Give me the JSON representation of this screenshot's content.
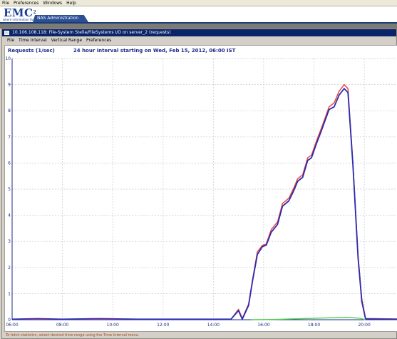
{
  "top_menu": [
    "File",
    "Preferences",
    "Windows",
    "Help"
  ],
  "brand": {
    "logo": "EMC",
    "tagline": "where information lives",
    "app_tab": "NAS Administration"
  },
  "window": {
    "title": "10.106.108.118: File-System Stella/FileSystems I/O on server_2 (requests)",
    "menu": [
      "File",
      "Time Interval",
      "Vertical Range",
      "Preferences"
    ]
  },
  "chart_header": {
    "metric": "Requests (1/sec)",
    "interval": "24 hour interval starting on Wed, Feb 15, 2012, 06:00 IST"
  },
  "status_text": "To fetch statistics, select desired time range using the Time Interval menu.",
  "chart_data": {
    "type": "line",
    "title": "24 hour interval starting on Wed, Feb 15, 2012, 06:00 IST",
    "ylabel": "Requests (1/sec)",
    "xlabel": "",
    "x_unit": "hours",
    "xlim": [
      6.0,
      21.3
    ],
    "ylim": [
      0,
      10
    ],
    "x_ticks": [
      {
        "v": 6,
        "label": "06:00"
      },
      {
        "v": 8,
        "label": "08:00"
      },
      {
        "v": 10,
        "label": "10:00"
      },
      {
        "v": 12,
        "label": "12:00"
      },
      {
        "v": 14,
        "label": "14:00"
      },
      {
        "v": 16,
        "label": "16:00"
      },
      {
        "v": 18,
        "label": "18:00"
      },
      {
        "v": 20,
        "label": "20:00"
      }
    ],
    "y_ticks": [
      0,
      1,
      2,
      3,
      4,
      5,
      6,
      7,
      8,
      9,
      10
    ],
    "grid": true,
    "series": [
      {
        "color": "#e8403a",
        "points": [
          [
            6.0,
            0.02
          ],
          [
            14.7,
            0.02
          ],
          [
            15.0,
            0.4
          ],
          [
            15.15,
            0.05
          ],
          [
            15.4,
            0.6
          ],
          [
            15.55,
            1.5
          ],
          [
            15.75,
            2.6
          ],
          [
            15.95,
            2.85
          ],
          [
            16.1,
            2.9
          ],
          [
            16.3,
            3.45
          ],
          [
            16.55,
            3.75
          ],
          [
            16.75,
            4.45
          ],
          [
            17.0,
            4.65
          ],
          [
            17.2,
            5.05
          ],
          [
            17.35,
            5.4
          ],
          [
            17.55,
            5.55
          ],
          [
            17.75,
            6.2
          ],
          [
            17.9,
            6.3
          ],
          [
            18.1,
            6.85
          ],
          [
            18.3,
            7.35
          ],
          [
            18.45,
            7.75
          ],
          [
            18.6,
            8.15
          ],
          [
            18.8,
            8.3
          ],
          [
            19.0,
            8.75
          ],
          [
            19.2,
            9.0
          ],
          [
            19.35,
            8.85
          ],
          [
            19.55,
            6.0
          ],
          [
            19.75,
            2.5
          ],
          [
            19.9,
            0.8
          ],
          [
            20.05,
            0.05
          ],
          [
            21.3,
            0.03
          ]
        ]
      },
      {
        "color": "#2b2bb0",
        "points": [
          [
            6.0,
            0.02
          ],
          [
            7.0,
            0.04
          ],
          [
            8.0,
            0.02
          ],
          [
            9.5,
            0.04
          ],
          [
            11.0,
            0.02
          ],
          [
            14.7,
            0.02
          ],
          [
            15.0,
            0.35
          ],
          [
            15.15,
            0.02
          ],
          [
            15.4,
            0.55
          ],
          [
            15.55,
            1.45
          ],
          [
            15.75,
            2.5
          ],
          [
            15.95,
            2.8
          ],
          [
            16.1,
            2.85
          ],
          [
            16.3,
            3.35
          ],
          [
            16.55,
            3.65
          ],
          [
            16.75,
            4.35
          ],
          [
            17.0,
            4.55
          ],
          [
            17.2,
            4.95
          ],
          [
            17.35,
            5.3
          ],
          [
            17.55,
            5.45
          ],
          [
            17.75,
            6.1
          ],
          [
            17.9,
            6.2
          ],
          [
            18.1,
            6.75
          ],
          [
            18.3,
            7.25
          ],
          [
            18.45,
            7.65
          ],
          [
            18.6,
            8.05
          ],
          [
            18.8,
            8.15
          ],
          [
            19.0,
            8.6
          ],
          [
            19.2,
            8.85
          ],
          [
            19.35,
            8.7
          ],
          [
            19.55,
            5.9
          ],
          [
            19.75,
            2.4
          ],
          [
            19.9,
            0.7
          ],
          [
            20.05,
            0.03
          ],
          [
            21.3,
            0.02
          ]
        ]
      },
      {
        "color": "#4cd14c",
        "points": [
          [
            15.5,
            0.0
          ],
          [
            16.5,
            0.01
          ],
          [
            17.5,
            0.04
          ],
          [
            18.5,
            0.07
          ],
          [
            19.3,
            0.09
          ],
          [
            19.8,
            0.06
          ],
          [
            20.05,
            0.0
          ]
        ]
      }
    ]
  }
}
